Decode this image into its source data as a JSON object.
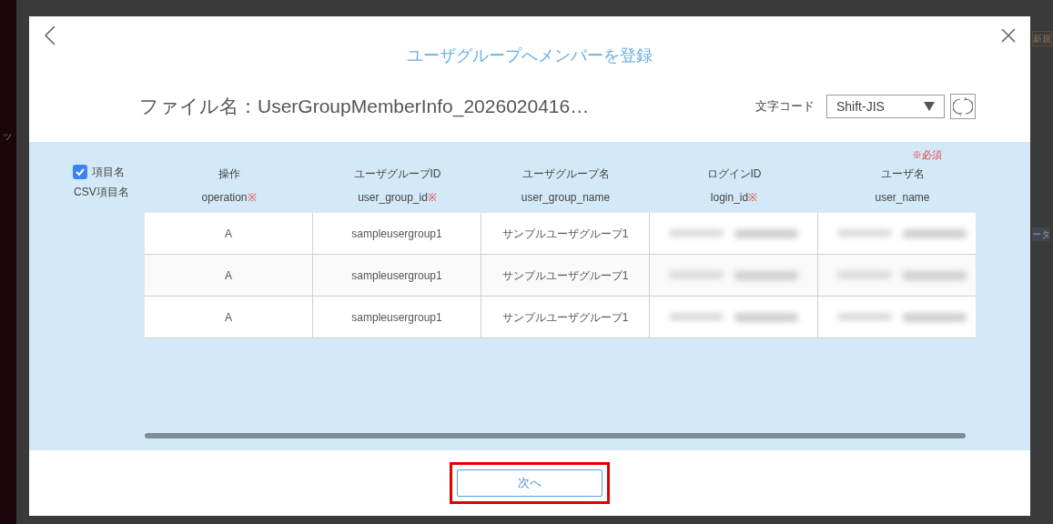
{
  "background": {
    "fragments": [
      "ッ",
      "新規",
      "ータ"
    ]
  },
  "dialog": {
    "title": "ユーザグループへメンバーを登録",
    "file_name": "ファイル名：UserGroupMemberInfo_2026020416…",
    "encoding": {
      "label": "文字コード",
      "value": "Shift-JIS"
    },
    "mapping": {
      "header_toggle": {
        "label": "項目名",
        "checked": true
      },
      "subheader": "CSV項目名",
      "required_note": "※必須",
      "columns": [
        {
          "name": "操作",
          "key": "operation",
          "required_mark": "※"
        },
        {
          "name": "ユーザグループID",
          "key": "user_group_id",
          "required_mark": "※"
        },
        {
          "name": "ユーザグループ名",
          "key": "user_group_name"
        },
        {
          "name": "ログインID",
          "key": "login_id",
          "required_mark": "※"
        },
        {
          "name": "ユーザ名",
          "key": "user_name"
        }
      ],
      "rows": [
        {
          "cells": [
            {
              "kind": "text",
              "text": "A"
            },
            {
              "kind": "text",
              "text": "sampleusergroup1"
            },
            {
              "kind": "text",
              "text": "サンプルユーザグループ1"
            },
            {
              "kind": "redacted"
            },
            {
              "kind": "redacted"
            }
          ]
        },
        {
          "cells": [
            {
              "kind": "text",
              "text": "A"
            },
            {
              "kind": "text",
              "text": "sampleusergroup1"
            },
            {
              "kind": "text",
              "text": "サンプルユーザグループ1"
            },
            {
              "kind": "redacted"
            },
            {
              "kind": "redacted"
            }
          ]
        },
        {
          "cells": [
            {
              "kind": "text",
              "text": "A"
            },
            {
              "kind": "text",
              "text": "sampleusergroup1"
            },
            {
              "kind": "text",
              "text": "サンプルユーザグループ1"
            },
            {
              "kind": "redacted"
            },
            {
              "kind": "redacted"
            }
          ]
        }
      ]
    },
    "next_button": {
      "label": "次へ",
      "highlighted": true
    }
  }
}
